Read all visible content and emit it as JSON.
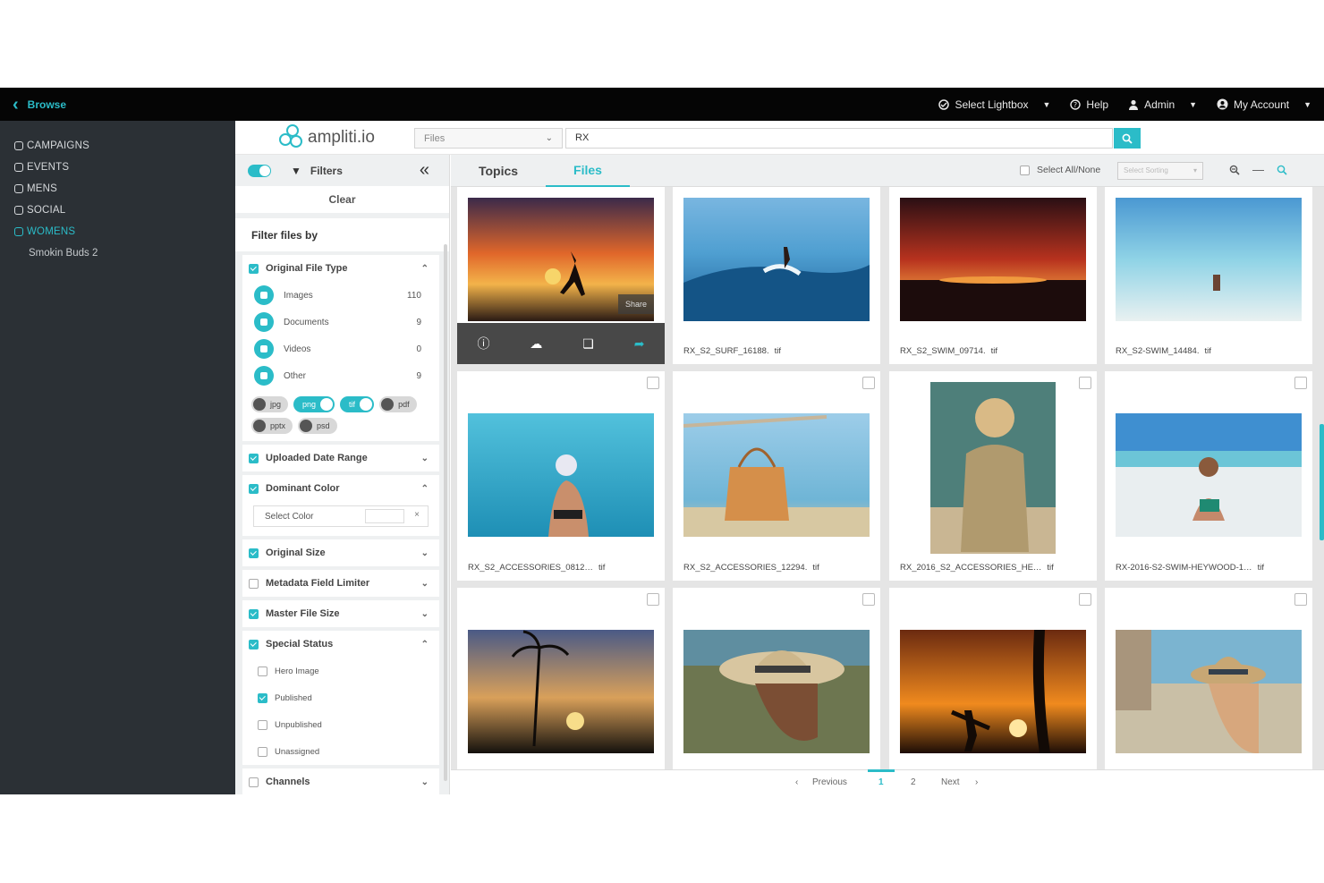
{
  "topbar": {
    "back_label": "Browse",
    "lightbox_label": "Select Lightbox",
    "help_label": "Help",
    "admin_label": "Admin",
    "account_label": "My Account"
  },
  "leftnav": {
    "items": [
      {
        "label": "CAMPAIGNS",
        "active": false
      },
      {
        "label": "EVENTS",
        "active": false
      },
      {
        "label": "MENS",
        "active": false
      },
      {
        "label": "SOCIAL",
        "active": false
      },
      {
        "label": "WOMENS",
        "active": true
      }
    ],
    "sub_item": "Smokin Buds 2"
  },
  "header": {
    "logo_text": "ampliti.io",
    "scope_value": "Files",
    "search_value": "RX"
  },
  "filters": {
    "title": "Filters",
    "clear_label": "Clear",
    "filter_by_label": "Filter files by",
    "file_type": {
      "title": "Original File Type",
      "checked": true,
      "rows": [
        {
          "label": "Images",
          "count": "110"
        },
        {
          "label": "Documents",
          "count": "9"
        },
        {
          "label": "Videos",
          "count": "0"
        },
        {
          "label": "Other",
          "count": "9"
        }
      ],
      "extensions": [
        {
          "label": "jpg",
          "on": false
        },
        {
          "label": "png",
          "on": true
        },
        {
          "label": "tif",
          "on": true
        },
        {
          "label": "pdf",
          "on": false
        },
        {
          "label": "pptx",
          "on": false
        },
        {
          "label": "psd",
          "on": false
        }
      ]
    },
    "groups": [
      {
        "title": "Uploaded Date Range",
        "checked": true
      },
      {
        "title": "Dominant Color",
        "checked": true
      },
      {
        "title": "Original Size",
        "checked": true
      },
      {
        "title": "Metadata Field Limiter",
        "checked": false
      },
      {
        "title": "Master File Size",
        "checked": true
      },
      {
        "title": "Special Status",
        "checked": true
      },
      {
        "title": "Channels",
        "checked": false
      }
    ],
    "color_placeholder": "Select Color",
    "color_clear": "×",
    "status_rows": [
      {
        "label": "Hero Image",
        "checked": false
      },
      {
        "label": "Published",
        "checked": true
      },
      {
        "label": "Unpublished",
        "checked": false
      },
      {
        "label": "Unassigned",
        "checked": false
      }
    ]
  },
  "main": {
    "tabs": [
      {
        "label": "Topics",
        "active": false
      },
      {
        "label": "Files",
        "active": true
      }
    ],
    "select_all_label": "Select All/None",
    "sort_placeholder": "Select Sorting"
  },
  "tiles": [
    {
      "name": "",
      "ext": "",
      "hover": true,
      "share_label": "Share"
    },
    {
      "name": "RX_S2_SURF_16188.",
      "ext": "tif"
    },
    {
      "name": "RX_S2_SWIM_09714.",
      "ext": "tif"
    },
    {
      "name": "RX_S2-SWIM_14484.",
      "ext": "tif"
    },
    {
      "name": "RX_S2_ACCESSORIES_0812…",
      "ext": "tif"
    },
    {
      "name": "RX_S2_ACCESSORIES_12294.",
      "ext": "tif"
    },
    {
      "name": "RX_2016_S2_ACCESSORIES_HE…",
      "ext": "tif"
    },
    {
      "name": "RX-2016-S2-SWIM-HEYWOOD-1…",
      "ext": "tif"
    },
    {
      "name": "",
      "ext": ""
    },
    {
      "name": "",
      "ext": ""
    },
    {
      "name": "",
      "ext": ""
    },
    {
      "name": "",
      "ext": ""
    }
  ],
  "pager": {
    "previous": "Previous",
    "pages": [
      "1",
      "2"
    ],
    "current": "1",
    "next": "Next"
  },
  "colors": {
    "accent": "#2bbcc8",
    "sidebar": "#2b3035",
    "topbar": "#050505"
  }
}
